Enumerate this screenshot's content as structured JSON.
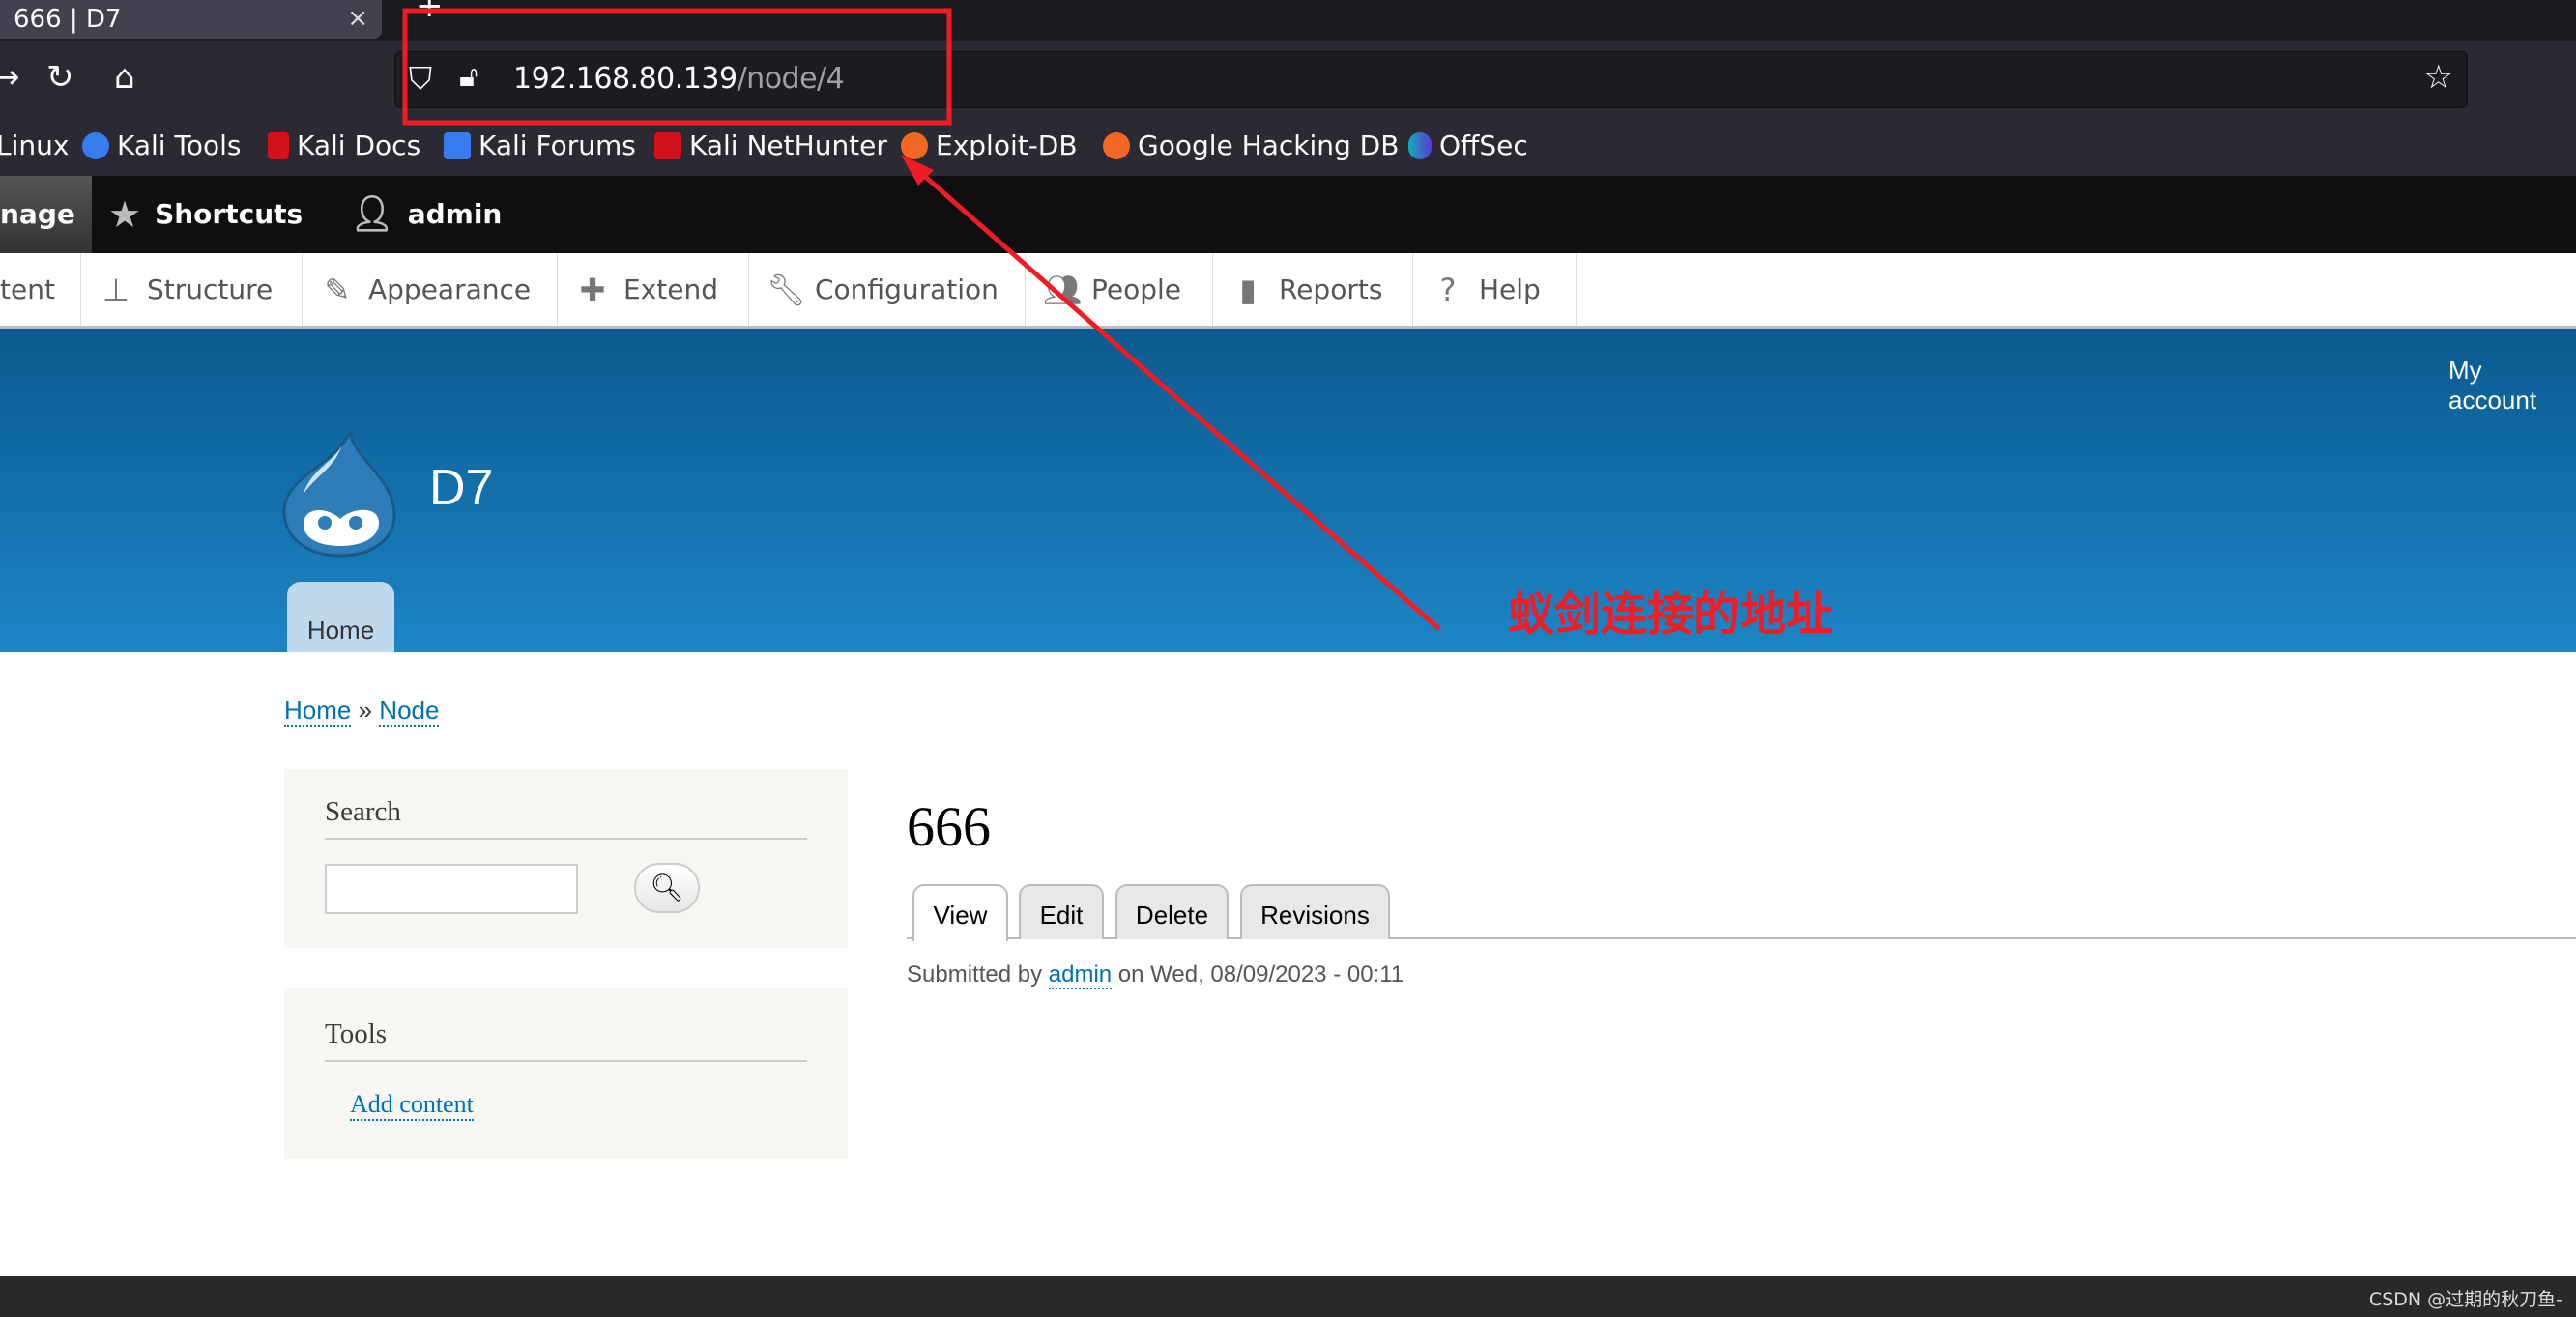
{
  "browser": {
    "tab_title": "666 | D7",
    "url_host": "192.168.80.139",
    "url_path": "/node/4",
    "bookmarks": [
      {
        "label": "Linux",
        "color": "#2b2a33"
      },
      {
        "label": "Kali Tools",
        "color": "#367bf0"
      },
      {
        "label": "Kali Docs",
        "color": "#d0121b"
      },
      {
        "label": "Kali Forums",
        "color": "#367bf0"
      },
      {
        "label": "Kali NetHunter",
        "color": "#d0121b"
      },
      {
        "label": "Exploit-DB",
        "color": "#f26722"
      },
      {
        "label": "Google Hacking DB",
        "color": "#f26722"
      },
      {
        "label": "OffSec",
        "color": "#5b3bd6"
      }
    ]
  },
  "admin_toolbar": {
    "manage": "nage",
    "shortcuts": "Shortcuts",
    "user": "admin"
  },
  "admin_menu": [
    {
      "label": "tent",
      "icon": "content-icon"
    },
    {
      "label": "Structure",
      "icon": "sitemap-icon"
    },
    {
      "label": "Appearance",
      "icon": "brush-icon"
    },
    {
      "label": "Extend",
      "icon": "puzzle-icon"
    },
    {
      "label": "Configuration",
      "icon": "wrench-icon"
    },
    {
      "label": "People",
      "icon": "people-icon"
    },
    {
      "label": "Reports",
      "icon": "bar-chart-icon"
    },
    {
      "label": "Help",
      "icon": "help-icon"
    }
  ],
  "site": {
    "name": "D7",
    "my_account": "My account",
    "home_tab": "Home"
  },
  "breadcrumb": {
    "home": "Home",
    "sep": "»",
    "node": "Node"
  },
  "sidebar": {
    "search_title": "Search",
    "search_value": "",
    "tools_title": "Tools",
    "add_content": "Add content"
  },
  "node": {
    "title": "666",
    "tabs": [
      "View",
      "Edit",
      "Delete",
      "Revisions"
    ],
    "active_tab": "View",
    "submitted_prefix": "Submitted by",
    "author": "admin",
    "submitted_suffix": "on Wed, 08/09/2023 - 00:11"
  },
  "annotation": {
    "text": "蚁剑连接的地址",
    "color": "#ee1c24"
  },
  "footer": {
    "watermark": "CSDN @过期的秋刀鱼-"
  }
}
